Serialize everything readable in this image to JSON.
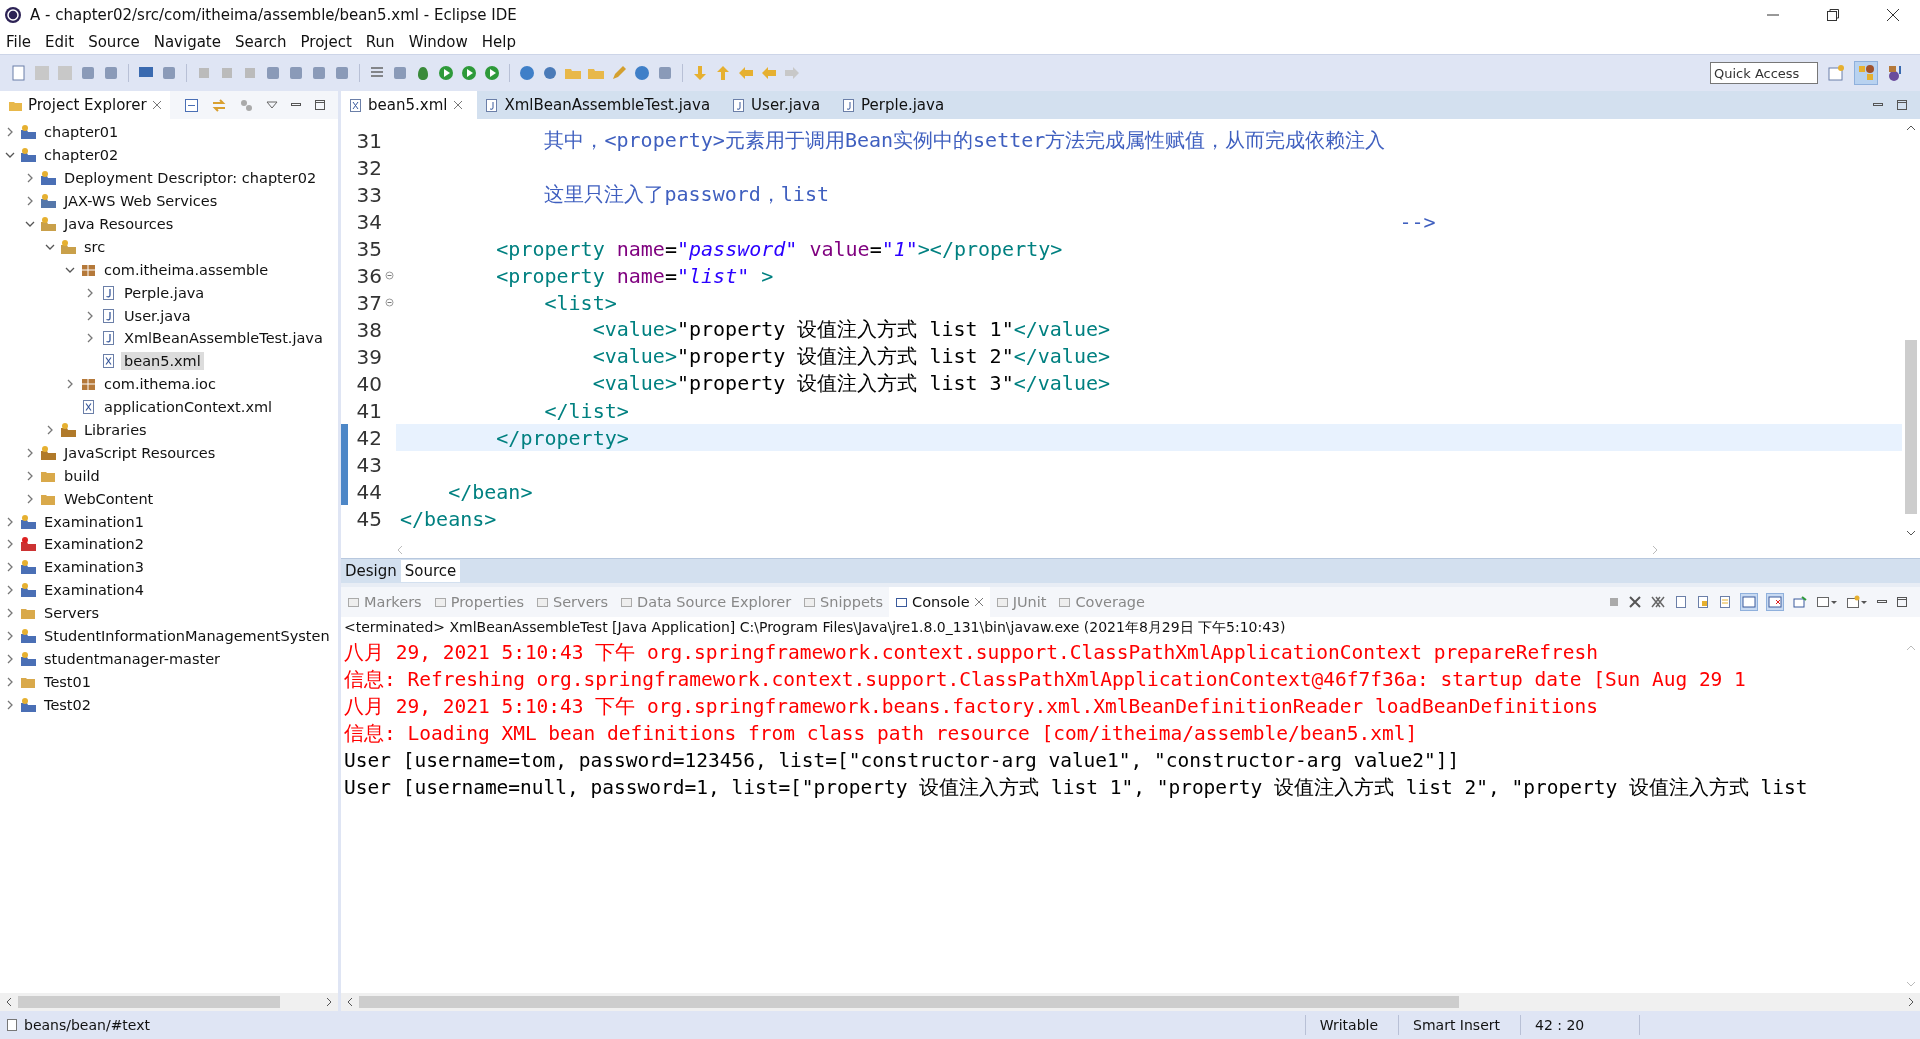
{
  "window": {
    "title": "A - chapter02/src/com/itheima/assemble/bean5.xml - Eclipse IDE"
  },
  "menu": [
    "File",
    "Edit",
    "Source",
    "Navigate",
    "Search",
    "Project",
    "Run",
    "Window",
    "Help"
  ],
  "quick_access": {
    "placeholder": "Quick Access"
  },
  "project_explorer": {
    "title": "Project Explorer",
    "tree": [
      {
        "label": "chapter01",
        "kind": "project",
        "expanded": false,
        "selected": false
      },
      {
        "label": "chapter02",
        "kind": "project",
        "expanded": true,
        "selected": false,
        "children": [
          {
            "label": "Deployment Descriptor: chapter02",
            "kind": "descriptor",
            "expanded": false,
            "selected": false
          },
          {
            "label": "JAX-WS Web Services",
            "kind": "webservice",
            "expanded": false,
            "selected": false
          },
          {
            "label": "Java Resources",
            "kind": "resources",
            "expanded": true,
            "selected": false,
            "children": [
              {
                "label": "src",
                "kind": "src",
                "expanded": true,
                "selected": false,
                "children": [
                  {
                    "label": "com.itheima.assemble",
                    "kind": "package",
                    "expanded": true,
                    "selected": false,
                    "children": [
                      {
                        "label": "Perple.java",
                        "kind": "java",
                        "expanded": false,
                        "selected": false
                      },
                      {
                        "label": "User.java",
                        "kind": "java",
                        "expanded": false,
                        "selected": false
                      },
                      {
                        "label": "XmlBeanAssembleTest.java",
                        "kind": "java",
                        "expanded": false,
                        "selected": false
                      },
                      {
                        "label": "bean5.xml",
                        "kind": "xml",
                        "selected": true
                      }
                    ]
                  },
                  {
                    "label": "com.ithema.ioc",
                    "kind": "package",
                    "expanded": false,
                    "selected": false
                  },
                  {
                    "label": "applicationContext.xml",
                    "kind": "xml",
                    "selected": false
                  }
                ]
              },
              {
                "label": "Libraries",
                "kind": "library",
                "expanded": false,
                "selected": false
              }
            ]
          },
          {
            "label": "JavaScript Resources",
            "kind": "library",
            "expanded": false,
            "selected": false
          },
          {
            "label": "build",
            "kind": "folder",
            "expanded": false,
            "selected": false
          },
          {
            "label": "WebContent",
            "kind": "folder",
            "expanded": false,
            "selected": false
          }
        ]
      },
      {
        "label": "Examination1",
        "kind": "project",
        "expanded": false,
        "selected": false
      },
      {
        "label": "Examination2",
        "kind": "project-error",
        "expanded": false,
        "selected": false
      },
      {
        "label": "Examination3",
        "kind": "project",
        "expanded": false,
        "selected": false
      },
      {
        "label": "Examination4",
        "kind": "project",
        "expanded": false,
        "selected": false
      },
      {
        "label": "Servers",
        "kind": "folder",
        "expanded": false,
        "selected": false
      },
      {
        "label": "StudentInformationManagementSysten",
        "kind": "project",
        "expanded": false,
        "selected": false
      },
      {
        "label": "studentmanager-master",
        "kind": "project",
        "expanded": false,
        "selected": false
      },
      {
        "label": "Test01",
        "kind": "folder",
        "expanded": false,
        "selected": false
      },
      {
        "label": "Test02",
        "kind": "project",
        "expanded": false,
        "selected": false
      }
    ]
  },
  "editor_tabs": [
    {
      "label": "bean5.xml",
      "kind": "xml",
      "selected": true
    },
    {
      "label": "XmlBeanAssembleTest.java",
      "kind": "java",
      "selected": false
    },
    {
      "label": "User.java",
      "kind": "java",
      "selected": false
    },
    {
      "label": "Perple.java",
      "kind": "java",
      "selected": false
    }
  ],
  "code_lines": [
    {
      "number": "31",
      "fold": false,
      "current": false,
      "changed": false,
      "parts": [
        {
          "kind": "comment",
          "text": "            其中，<property>元素用于调用Bean实例中的setter方法完成属性赋值，从而完成依赖注入"
        }
      ]
    },
    {
      "number": "32",
      "fold": false,
      "current": false,
      "changed": false
    },
    {
      "number": "33",
      "fold": false,
      "current": false,
      "changed": false,
      "parts": [
        {
          "kind": "comment",
          "text": "            这里只注入了password，list"
        }
      ]
    },
    {
      "number": "34",
      "fold": false,
      "current": false,
      "changed": false,
      "parts": [
        {
          "kind": "comment",
          "text": "                                                                                   -->"
        }
      ]
    },
    {
      "number": "35",
      "fold": false,
      "current": false,
      "changed": false,
      "parts": [
        {
          "kind": "tag",
          "text": "        <property "
        },
        {
          "kind": "attr",
          "text": "name"
        },
        {
          "kind": "text",
          "text": "="
        },
        {
          "kind": "string",
          "text": "\"password\" "
        },
        {
          "kind": "attr",
          "text": "value"
        },
        {
          "kind": "text",
          "text": "="
        },
        {
          "kind": "string",
          "text": "\"1\""
        },
        {
          "kind": "tag",
          "text": "></property>"
        }
      ]
    },
    {
      "number": "36",
      "fold": true,
      "current": false,
      "changed": false,
      "parts": [
        {
          "kind": "tag",
          "text": "        <property "
        },
        {
          "kind": "attr",
          "text": "name"
        },
        {
          "kind": "text",
          "text": "="
        },
        {
          "kind": "string",
          "text": "\"list\""
        },
        {
          "kind": "tag",
          "text": " >"
        }
      ]
    },
    {
      "number": "37",
      "fold": true,
      "current": false,
      "changed": false,
      "parts": [
        {
          "kind": "tag",
          "text": "            <list>"
        }
      ]
    },
    {
      "number": "38",
      "fold": false,
      "current": false,
      "changed": false,
      "parts": [
        {
          "kind": "tag",
          "text": "                <value>"
        },
        {
          "kind": "text",
          "text": "\"property 设值注入方式 list 1\""
        },
        {
          "kind": "tag",
          "text": "</value>"
        }
      ]
    },
    {
      "number": "39",
      "fold": false,
      "current": false,
      "changed": false,
      "parts": [
        {
          "kind": "tag",
          "text": "                <value>"
        },
        {
          "kind": "text",
          "text": "\"property 设值注入方式 list 2\""
        },
        {
          "kind": "tag",
          "text": "</value>"
        }
      ]
    },
    {
      "number": "40",
      "fold": false,
      "current": false,
      "changed": false,
      "parts": [
        {
          "kind": "tag",
          "text": "                <value>"
        },
        {
          "kind": "text",
          "text": "\"property 设值注入方式 list 3\""
        },
        {
          "kind": "tag",
          "text": "</value>"
        }
      ]
    },
    {
      "number": "41",
      "fold": false,
      "current": false,
      "changed": false,
      "parts": [
        {
          "kind": "tag",
          "text": "            </list>"
        }
      ]
    },
    {
      "number": "42",
      "fold": false,
      "current": true,
      "changed": true,
      "parts": [
        {
          "kind": "tag",
          "text": "        </property>"
        }
      ]
    },
    {
      "number": "43",
      "fold": false,
      "current": false,
      "changed": true
    },
    {
      "number": "44",
      "fold": false,
      "current": false,
      "changed": true,
      "parts": [
        {
          "kind": "tag",
          "text": "    </bean>"
        }
      ]
    },
    {
      "number": "45",
      "fold": false,
      "current": false,
      "changed": false,
      "parts": [
        {
          "kind": "tag",
          "text": "</beans>"
        }
      ]
    }
  ],
  "editor_mode_tabs": [
    {
      "label": "Design",
      "selected": false
    },
    {
      "label": "Source",
      "selected": true
    }
  ],
  "view_tabs": [
    {
      "label": "Markers",
      "selected": false
    },
    {
      "label": "Properties",
      "selected": false
    },
    {
      "label": "Servers",
      "selected": false
    },
    {
      "label": "Data Source Explorer",
      "selected": false
    },
    {
      "label": "Snippets",
      "selected": false
    },
    {
      "label": "Console",
      "selected": true
    },
    {
      "label": "JUnit",
      "selected": false
    },
    {
      "label": "Coverage",
      "selected": false
    }
  ],
  "console": {
    "header": "<terminated> XmlBeanAssembleTest [Java Application] C:\\Program Files\\Java\\jre1.8.0_131\\bin\\javaw.exe (2021年8月29日 下午5:10:43)",
    "lines": [
      {
        "kind": "error",
        "text": "八月 29, 2021 5:10:43 下午 org.springframework.context.support.ClassPathXmlApplicationContext prepareRefresh"
      },
      {
        "kind": "error",
        "text": "信息: Refreshing org.springframework.context.support.ClassPathXmlApplicationContext@46f7f36a: startup date [Sun Aug 29 1"
      },
      {
        "kind": "error",
        "text": "八月 29, 2021 5:10:43 下午 org.springframework.beans.factory.xml.XmlBeanDefinitionReader loadBeanDefinitions"
      },
      {
        "kind": "error",
        "text": "信息: Loading XML bean definitions from class path resource [com/itheima/assemble/bean5.xml]"
      },
      {
        "kind": "output",
        "text": "User [username=tom, password=123456, list=[\"constructor-arg value1\", \"constructor-arg value2\"]]"
      },
      {
        "kind": "output",
        "text": "User [username=null, password=1, list=[\"property 设值注入方式 list 1\", \"property 设值注入方式 list 2\", \"property 设值注入方式 list"
      }
    ]
  },
  "status_bar": {
    "path": "beans/bean/#text",
    "mode": "Writable",
    "insert": "Smart Insert",
    "position": "42 : 20"
  }
}
